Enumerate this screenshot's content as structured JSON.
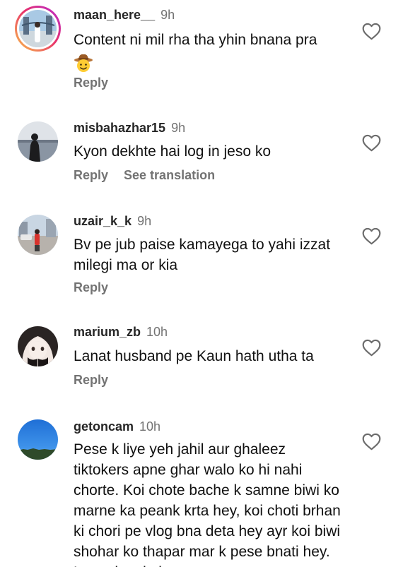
{
  "comments": [
    {
      "username": "maan_here__",
      "time": "9h",
      "text": "Content ni mil rha tha yhin bnana pra",
      "emoji": "cowboy-hat-face",
      "reply_label": "Reply"
    },
    {
      "username": "misbahazhar15",
      "time": "9h",
      "text": "Kyon dekhte hai log in jeso ko",
      "reply_label": "Reply",
      "translation_label": "See translation"
    },
    {
      "username": "uzair_k_k",
      "time": "9h",
      "text": "Bv pe jub paise kamayega to yahi izzat milegi ma or kia",
      "reply_label": "Reply"
    },
    {
      "username": "marium_zb",
      "time": "10h",
      "text": "Lanat husband pe Kaun hath utha ta",
      "reply_label": "Reply"
    },
    {
      "username": "getoncam",
      "time": "10h",
      "text": "Pese k liye yeh jahil aur ghaleez tiktokers apne ghar walo ko hi nahi chorte. Koi chote bache k samne biwi ko marne ka peank krta hey, koi choti brhan ki chori pe vlog bna deta hey ayr koi biwi shohar ko thapar mar k pese bnati hey. Lanat hey in logon pe."
    }
  ],
  "icons": {
    "like": "heart-outline-icon"
  },
  "colors": {
    "username": "#262626",
    "secondary": "#737373",
    "story_ring_start": "#f9c449",
    "story_ring_end": "#b62dd4"
  }
}
